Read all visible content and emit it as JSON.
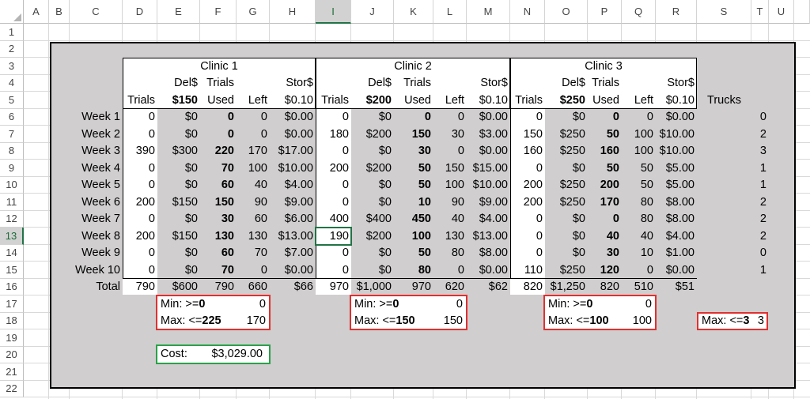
{
  "columns": [
    "A",
    "B",
    "C",
    "D",
    "E",
    "F",
    "G",
    "H",
    "I",
    "J",
    "K",
    "L",
    "M",
    "N",
    "O",
    "P",
    "Q",
    "R",
    "S",
    "T",
    "U"
  ],
  "rows": [
    1,
    2,
    3,
    4,
    5,
    6,
    7,
    8,
    9,
    10,
    11,
    12,
    13,
    14,
    15,
    16,
    17,
    18,
    19,
    20,
    21,
    22
  ],
  "selected_cell": "I13",
  "clinics": [
    {
      "title": "Clinic 1",
      "del_price": "$150",
      "stor_rate": "$0.10"
    },
    {
      "title": "Clinic 2",
      "del_price": "$200",
      "stor_rate": "$0.10"
    },
    {
      "title": "Clinic 3",
      "del_price": "$250",
      "stor_rate": "$0.10"
    }
  ],
  "headers": {
    "del": "Del$",
    "trials": "Trials",
    "trials_used_top": "Trials",
    "used": "Used",
    "left": "Left",
    "stor": "Stor$",
    "trucks": "Trucks"
  },
  "weeks": [
    {
      "label": "Week 1",
      "c1": [
        "0",
        "$0",
        "0",
        "0",
        "$0.00"
      ],
      "c2": [
        "0",
        "$0",
        "0",
        "0",
        "$0.00"
      ],
      "c3": [
        "0",
        "$0",
        "0",
        "0",
        "$0.00"
      ],
      "trucks": "0"
    },
    {
      "label": "Week 2",
      "c1": [
        "0",
        "$0",
        "0",
        "0",
        "$0.00"
      ],
      "c2": [
        "180",
        "$200",
        "150",
        "30",
        "$3.00"
      ],
      "c3": [
        "150",
        "$250",
        "50",
        "100",
        "$10.00"
      ],
      "trucks": "2"
    },
    {
      "label": "Week 3",
      "c1": [
        "390",
        "$300",
        "220",
        "170",
        "$17.00"
      ],
      "c2": [
        "0",
        "$0",
        "30",
        "0",
        "$0.00"
      ],
      "c3": [
        "160",
        "$250",
        "160",
        "100",
        "$10.00"
      ],
      "trucks": "3"
    },
    {
      "label": "Week 4",
      "c1": [
        "0",
        "$0",
        "70",
        "100",
        "$10.00"
      ],
      "c2": [
        "200",
        "$200",
        "50",
        "150",
        "$15.00"
      ],
      "c3": [
        "0",
        "$0",
        "50",
        "50",
        "$5.00"
      ],
      "trucks": "1"
    },
    {
      "label": "Week 5",
      "c1": [
        "0",
        "$0",
        "60",
        "40",
        "$4.00"
      ],
      "c2": [
        "0",
        "$0",
        "50",
        "100",
        "$10.00"
      ],
      "c3": [
        "200",
        "$250",
        "200",
        "50",
        "$5.00"
      ],
      "trucks": "1"
    },
    {
      "label": "Week 6",
      "c1": [
        "200",
        "$150",
        "150",
        "90",
        "$9.00"
      ],
      "c2": [
        "0",
        "$0",
        "10",
        "90",
        "$9.00"
      ],
      "c3": [
        "200",
        "$250",
        "170",
        "80",
        "$8.00"
      ],
      "trucks": "2"
    },
    {
      "label": "Week 7",
      "c1": [
        "0",
        "$0",
        "30",
        "60",
        "$6.00"
      ],
      "c2": [
        "400",
        "$400",
        "450",
        "40",
        "$4.00"
      ],
      "c3": [
        "0",
        "$0",
        "0",
        "80",
        "$8.00"
      ],
      "trucks": "2"
    },
    {
      "label": "Week 8",
      "c1": [
        "200",
        "$150",
        "130",
        "130",
        "$13.00"
      ],
      "c2": [
        "190",
        "$200",
        "100",
        "130",
        "$13.00"
      ],
      "c3": [
        "0",
        "$0",
        "40",
        "40",
        "$4.00"
      ],
      "trucks": "2"
    },
    {
      "label": "Week 9",
      "c1": [
        "0",
        "$0",
        "60",
        "70",
        "$7.00"
      ],
      "c2": [
        "0",
        "$0",
        "50",
        "80",
        "$8.00"
      ],
      "c3": [
        "0",
        "$0",
        "30",
        "10",
        "$1.00"
      ],
      "trucks": "0"
    },
    {
      "label": "Week 10",
      "c1": [
        "0",
        "$0",
        "70",
        "0",
        "$0.00"
      ],
      "c2": [
        "0",
        "$0",
        "80",
        "0",
        "$0.00"
      ],
      "c3": [
        "110",
        "$250",
        "120",
        "0",
        "$0.00"
      ],
      "trucks": "1"
    }
  ],
  "totals": {
    "label": "Total",
    "c1": [
      "790",
      "$600",
      "790",
      "660",
      "$66"
    ],
    "c2": [
      "970",
      "$1,000",
      "970",
      "620",
      "$62"
    ],
    "c3": [
      "820",
      "$1,250",
      "820",
      "510",
      "$51"
    ]
  },
  "constraints": [
    {
      "min_label": "Min: >=",
      "min_val": "0",
      "min_result": "0",
      "max_label": "Max: <=",
      "max_val": "225",
      "max_result": "170"
    },
    {
      "min_label": "Min: >=",
      "min_val": "0",
      "min_result": "0",
      "max_label": "Max: <=",
      "max_val": "150",
      "max_result": "150"
    },
    {
      "min_label": "Min: >=",
      "min_val": "0",
      "min_result": "0",
      "max_label": "Max: <=",
      "max_val": "100",
      "max_result": "100"
    }
  ],
  "truck_constraint": {
    "label": "Max: <=",
    "val": "3",
    "result": "3"
  },
  "cost": {
    "label": "Cost:",
    "value": "$3,029.00"
  },
  "colors": {
    "panel_bg": "#d0cece",
    "selection": "#217346",
    "constraint_border": "#e03030",
    "cost_border": "#2aa14a"
  }
}
